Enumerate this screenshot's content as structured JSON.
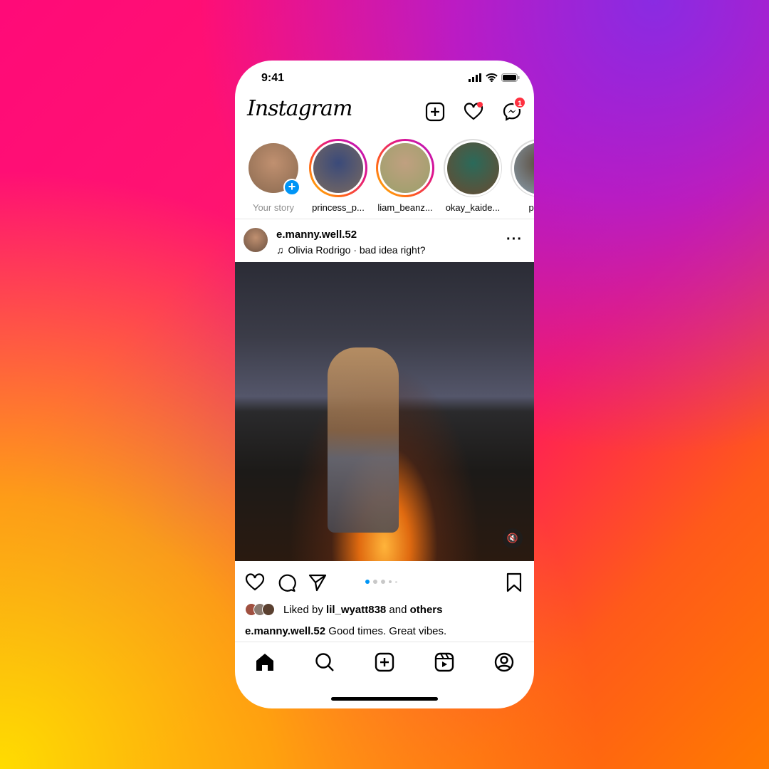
{
  "status_bar": {
    "time": "9:41"
  },
  "header": {
    "logo": "Instagram",
    "messages_badge": "1",
    "icons": [
      "new-post-icon",
      "heart-icon",
      "messenger-icon"
    ]
  },
  "stories": [
    {
      "label": "Your story",
      "own": true,
      "colors": [
        "#8a6a50",
        "#c09070"
      ]
    },
    {
      "label": "princess_p...",
      "own": false,
      "colors": [
        "#7a6a60",
        "#3a4a7a"
      ]
    },
    {
      "label": "liam_beanz...",
      "own": false,
      "colors": [
        "#9aa06a",
        "#c0a080"
      ]
    },
    {
      "label": "okay_kaide...",
      "own": false,
      "seen": true,
      "colors": [
        "#6a4a30",
        "#2a6a5a"
      ]
    },
    {
      "label": "pia.in",
      "own": false,
      "seen": true,
      "colors": [
        "#8aa0b0",
        "#5a4a3a"
      ]
    }
  ],
  "post": {
    "username": "e.manny.well.52",
    "audio": "Olivia Rodrigo · bad idea right?",
    "carousel_count": 5,
    "carousel_active": 1,
    "liked_by_prefix": "Liked by ",
    "liked_by_user": "lil_wyatt838",
    "liked_by_mid": " and ",
    "liked_by_suffix": "others",
    "caption_user": "e.manny.well.52",
    "caption_text": " Good times. Great vibes."
  },
  "nav": [
    "home-icon",
    "search-icon",
    "create-icon",
    "reels-icon",
    "profile-icon"
  ],
  "colors": {
    "accent": "#0095f6",
    "badge": "#ff3040"
  }
}
